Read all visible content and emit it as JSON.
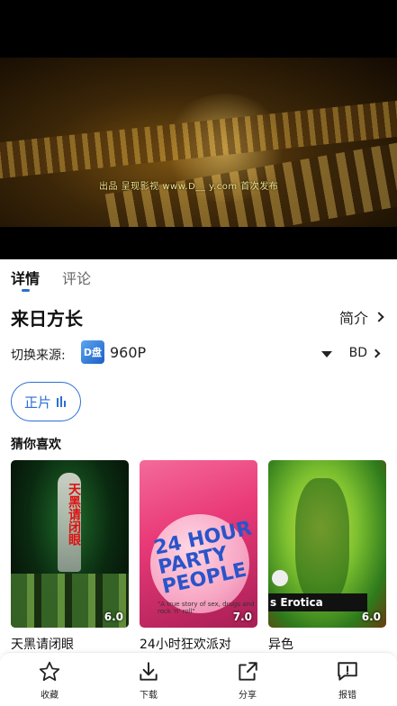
{
  "player": {
    "subtitle": "出品  呈现影视  www.D__ y.com  首次发布"
  },
  "tabs": [
    {
      "label": "详情"
    },
    {
      "label": "评论"
    }
  ],
  "movie": {
    "title": "来日方长",
    "intro_label": "简介"
  },
  "source": {
    "label": "切换来源:",
    "logo_text": "D盘",
    "value": "960P",
    "quality": "BD"
  },
  "episode": {
    "label": "正片"
  },
  "recommend": {
    "title": "猜你喜欢",
    "items": [
      {
        "title": "天黑请闭眼",
        "rating": "6.0",
        "poster_text": "天黑请闭眼"
      },
      {
        "title": "24小时狂欢派对",
        "rating": "7.0",
        "poster_text": "24 HOUR PARTY PEOPLE",
        "poster_small": "\"A true story of sex, drugs and rock 'n' roll\""
      },
      {
        "title": "异色",
        "rating": "6.0",
        "poster_text": "s Erotica"
      }
    ]
  },
  "bottom_nav": [
    {
      "label": "收藏",
      "icon": "star-icon"
    },
    {
      "label": "下载",
      "icon": "download-icon"
    },
    {
      "label": "分享",
      "icon": "share-icon"
    },
    {
      "label": "报错",
      "icon": "report-icon"
    }
  ],
  "colors": {
    "accent": "#2a6fd6"
  }
}
